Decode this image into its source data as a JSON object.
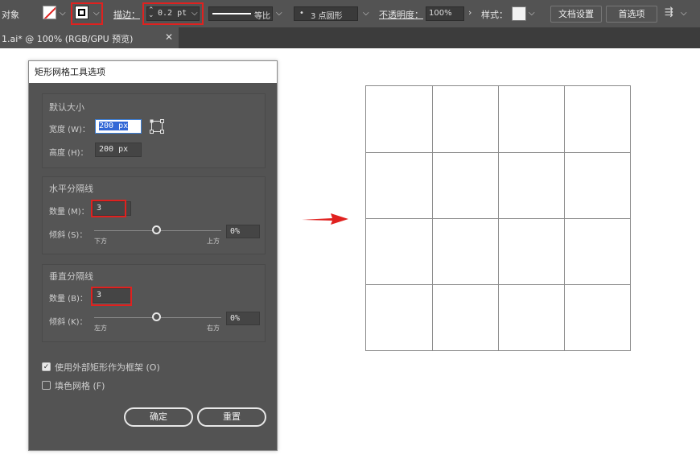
{
  "control_bar": {
    "object_label": "对象",
    "stroke_label": "描边：",
    "stroke_weight": "0.2 pt",
    "profile_label": "等比",
    "brush_label": "3 点圆形",
    "opacity_label": "不透明度：",
    "opacity_value": "100%",
    "style_label": "样式：",
    "doc_setup_button": "文档设置",
    "preferences_button": "首选项"
  },
  "document_tab": {
    "title": "1.ai* @ 100% (RGB/GPU 预览)"
  },
  "dialog": {
    "title": "矩形网格工具选项",
    "default_size": {
      "section_label": "默认大小",
      "width_label": "宽度 (W)：",
      "width_value": "200 px",
      "height_label": "高度 (H)：",
      "height_value": "200 px"
    },
    "horizontal_dividers": {
      "section_label": "水平分隔线",
      "number_label": "数量 (M)：",
      "number_value": "3",
      "skew_label": "倾斜 (S)：",
      "skew_value": "0%",
      "skew_position": 0.5,
      "min_label": "下方",
      "max_label": "上方"
    },
    "vertical_dividers": {
      "section_label": "垂直分隔线",
      "number_label": "数量 (B)：",
      "number_value": "3",
      "skew_label": "倾斜 (K)：",
      "skew_value": "0%",
      "skew_position": 0.5,
      "min_label": "左方",
      "max_label": "右方"
    },
    "use_outside_rect": {
      "label": "使用外部矩形作为框架 (O)",
      "checked": true
    },
    "fill_grid": {
      "label": "填色网格 (F)",
      "checked": false
    },
    "ok_button": "确定",
    "reset_button": "重置"
  },
  "result_grid": {
    "rows": 4,
    "columns": 4
  },
  "colors": {
    "highlight_red": "#e0211f",
    "panel_gray": "#535353"
  }
}
